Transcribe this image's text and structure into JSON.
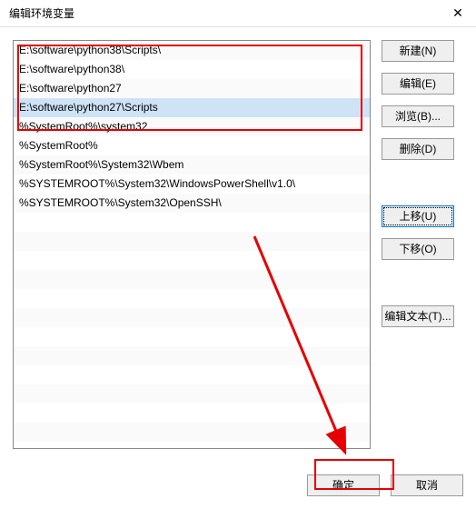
{
  "title": "编辑环境变量",
  "list_items": [
    "E:\\software\\python38\\Scripts\\",
    "E:\\software\\python38\\",
    "E:\\software\\python27",
    "E:\\software\\python27\\Scripts",
    "%SystemRoot%\\system32",
    "%SystemRoot%",
    "%SystemRoot%\\System32\\Wbem",
    "%SYSTEMROOT%\\System32\\WindowsPowerShell\\v1.0\\",
    "%SYSTEMROOT%\\System32\\OpenSSH\\"
  ],
  "selected_index": 3,
  "buttons": {
    "new": "新建(N)",
    "edit": "编辑(E)",
    "browse": "浏览(B)...",
    "delete": "删除(D)",
    "moveup": "上移(U)",
    "movedown": "下移(O)",
    "edittext": "编辑文本(T)...",
    "ok": "确定",
    "cancel": "取消"
  },
  "highlight_color": "#e60000"
}
